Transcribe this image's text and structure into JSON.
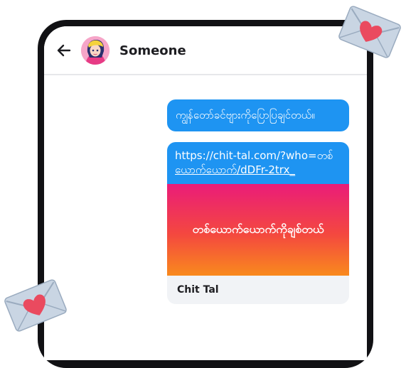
{
  "chat": {
    "contact_name": "Someone"
  },
  "messages": [
    {
      "text": "ကျွန်တော်ခင်ဗျားကိုပြောပြချင်တယ်။"
    }
  ],
  "link_message": {
    "line1": "https://chit-tal.com/?who=တစ်",
    "line2": "ယောက်ယောက်/dDFr-2trx_",
    "preview_text": "တစ်ယောက်ယောက်ကိုချစ်တယ်",
    "site_name": "Chit Tal"
  },
  "colors": {
    "bubble": "#1e94f2",
    "preview_gradient_top": "#ea1c79",
    "preview_gradient_bottom": "#f98a1d",
    "heart": "#ea4a5f",
    "envelope": "#c9d5e3"
  },
  "icons": [
    "back-arrow-icon",
    "love-letter-icon"
  ]
}
